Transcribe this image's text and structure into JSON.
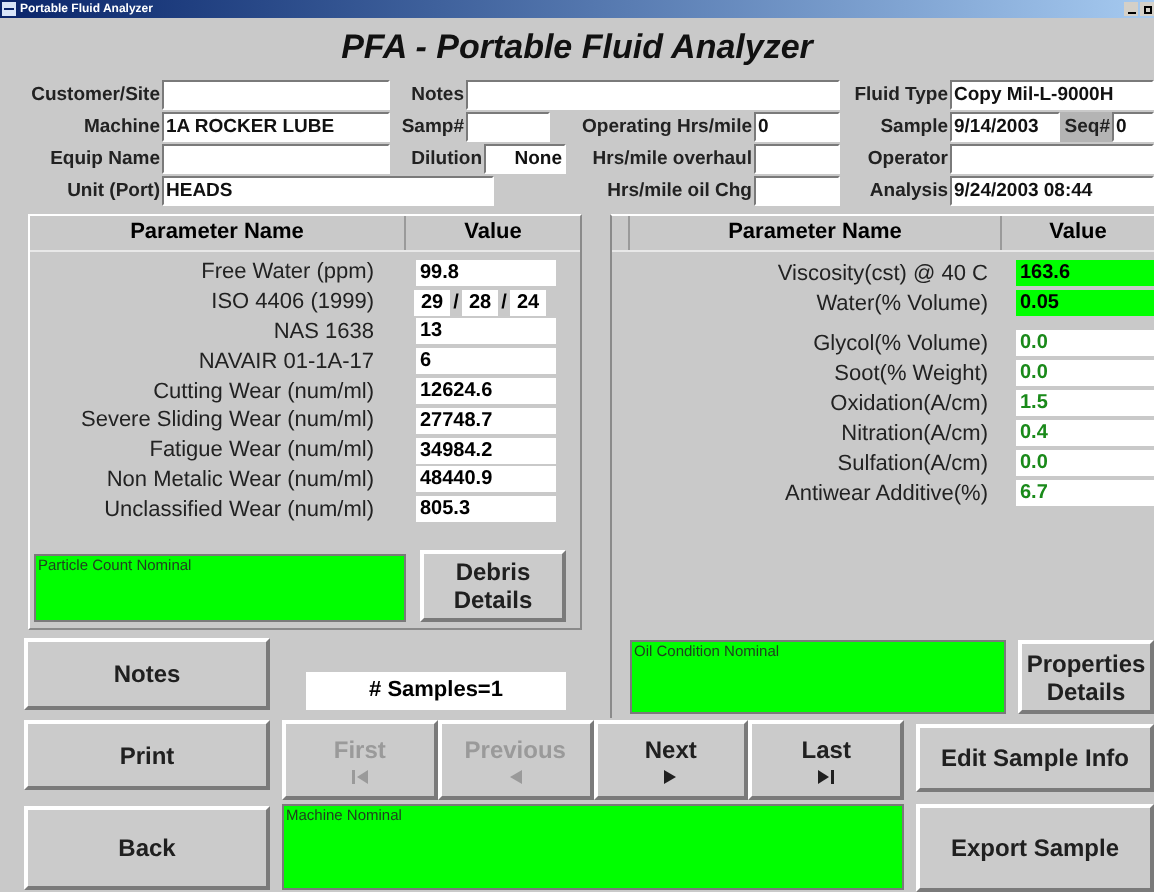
{
  "window": {
    "title": "Portable Fluid Analyzer"
  },
  "heading": "PFA - Portable Fluid Analyzer",
  "info_rows": [
    {
      "fields": [
        {
          "label": "Customer/Site"
        },
        {
          "label": "Notes"
        },
        {
          "label": "Fluid Type",
          "value": "Copy Mil-L-9000H"
        }
      ]
    },
    {
      "fields": [
        {
          "label": "Machine",
          "value": "1A ROCKER LUBE"
        },
        {
          "label": "Samp#"
        },
        {
          "label": "Operating Hrs/mile",
          "value": "0"
        },
        {
          "label": "Sample",
          "value": "9/14/2003"
        },
        {
          "label": "Seq#",
          "value": "0"
        }
      ]
    },
    {
      "fields": [
        {
          "label": "Equip Name"
        },
        {
          "label": "Dilution",
          "value": "None"
        },
        {
          "label": "Hrs/mile overhaul"
        },
        {
          "label": "Operator"
        }
      ]
    },
    {
      "fields": [
        {
          "label": "Unit (Port)",
          "value": "HEADS"
        },
        {
          "label": "Hrs/mile oil Chg"
        },
        {
          "label": "Analysis",
          "value": "9/24/2003 08:44"
        }
      ]
    }
  ],
  "particle_table": {
    "columns": [
      "Parameter Name",
      "Value"
    ],
    "rows": [
      {
        "kind": "single",
        "name": "Free Water (ppm)",
        "value": "99.8"
      },
      {
        "kind": "iso",
        "name": "ISO 4406 (1999)",
        "values": [
          "29",
          "28",
          "24"
        ],
        "separator": "/"
      },
      {
        "kind": "single",
        "name": "NAS 1638",
        "value": "13"
      },
      {
        "kind": "single",
        "name": "NAVAIR 01-1A-17",
        "value": "6"
      },
      {
        "kind": "single",
        "name": "Cutting Wear (num/ml)",
        "value": "12624.6"
      },
      {
        "kind": "single",
        "name": "Severe Sliding Wear (num/ml)",
        "value": "27748.7"
      },
      {
        "kind": "single",
        "name": "Fatigue Wear (num/ml)",
        "value": "34984.2"
      },
      {
        "kind": "single",
        "name": "Non Metalic Wear (num/ml)",
        "value": "48440.9"
      },
      {
        "kind": "single",
        "name": "Unclassified Wear (num/ml)",
        "value": "805.3"
      }
    ]
  },
  "particle_status": "Particle Count Nominal",
  "debris_button": "Debris Details",
  "oil_table": {
    "columns": [
      "Parameter Name",
      "Value"
    ],
    "rows": [
      {
        "name": "Viscosity(cst) @ 40 C",
        "value": "163.6",
        "highlighted": true
      },
      {
        "name": "Water(% Volume)",
        "value": "0.05",
        "highlighted": true
      },
      {
        "name": "Glycol(% Volume)",
        "value": "0.0",
        "highlighted": false
      },
      {
        "name": "Soot(% Weight)",
        "value": "0.0",
        "highlighted": false
      },
      {
        "name": "Oxidation(A/cm)",
        "value": "1.5",
        "highlighted": false
      },
      {
        "name": "Nitration(A/cm)",
        "value": "0.4",
        "highlighted": false
      },
      {
        "name": "Sulfation(A/cm)",
        "value": "0.0",
        "highlighted": false
      },
      {
        "name": "Antiwear Additive(%)",
        "value": "6.7",
        "highlighted": false
      }
    ]
  },
  "oil_status": "Oil Condition Nominal",
  "properties_button": "Properties Details",
  "notes_button": "Notes",
  "samples_count": "# Samples=1",
  "print_button": "Print",
  "navigation": [
    {
      "kind": "first",
      "label": "First",
      "disabled": true
    },
    {
      "kind": "previous",
      "label": "Previous",
      "disabled": true
    },
    {
      "kind": "next",
      "label": "Next",
      "disabled": false
    },
    {
      "kind": "last",
      "label": "Last",
      "disabled": false
    }
  ],
  "edit_button": "Edit Sample Info",
  "back_button": "Back",
  "machine_status": "Machine Nominal",
  "export_button": "Export Sample"
}
